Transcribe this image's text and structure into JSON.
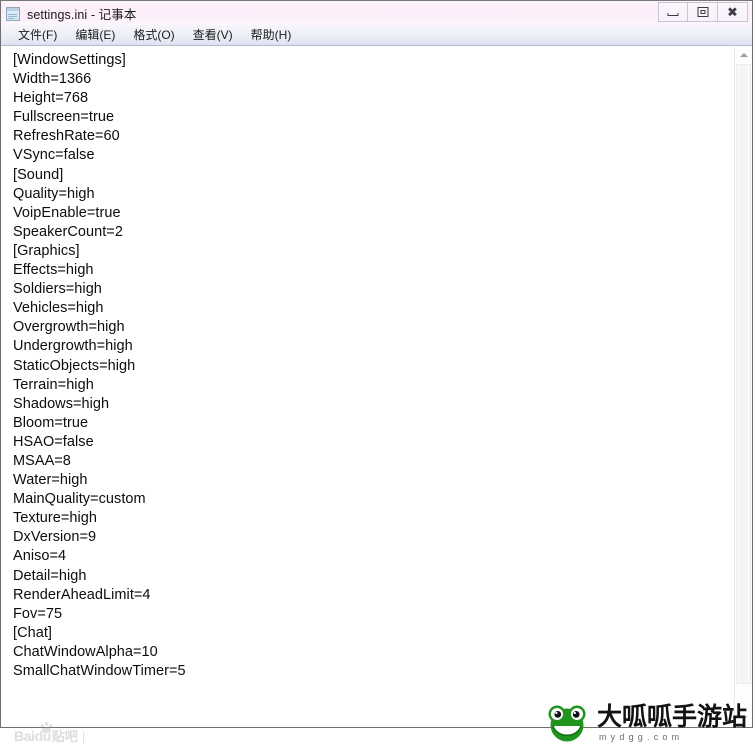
{
  "window": {
    "title": "settings.ini - 记事本",
    "icon": "notepad-icon",
    "controls": {
      "minimize": "最小化",
      "maximize": "最大化",
      "close": "关闭"
    }
  },
  "menu": {
    "items": [
      {
        "label": "文件(F)",
        "name": "menu-file"
      },
      {
        "label": "编辑(E)",
        "name": "menu-edit"
      },
      {
        "label": "格式(O)",
        "name": "menu-format"
      },
      {
        "label": "查看(V)",
        "name": "menu-view"
      },
      {
        "label": "帮助(H)",
        "name": "menu-help"
      }
    ]
  },
  "editor": {
    "filename": "settings.ini",
    "lines": [
      "[WindowSettings]",
      "Width=1366",
      "Height=768",
      "Fullscreen=true",
      "RefreshRate=60",
      "VSync=false",
      "[Sound]",
      "Quality=high",
      "VoipEnable=true",
      "SpeakerCount=2",
      "[Graphics]",
      "Effects=high",
      "Soldiers=high",
      "Vehicles=high",
      "Overgrowth=high",
      "Undergrowth=high",
      "StaticObjects=high",
      "Terrain=high",
      "Shadows=high",
      "Bloom=true",
      "HSAO=false",
      "MSAA=8",
      "Water=high",
      "MainQuality=custom",
      "Texture=high",
      "DxVersion=9",
      "Aniso=4",
      "Detail=high",
      "RenderAheadLimit=4",
      "Fov=75",
      "[Chat]",
      "ChatWindowAlpha=10",
      "SmallChatWindowTimer=5"
    ]
  },
  "scrollbar": {
    "up_arrow": "scroll-up-arrow-icon",
    "down_arrow": "scroll-down-arrow-icon"
  },
  "watermarks": {
    "baidu": {
      "brand": "Baidu",
      "section": "贴吧",
      "separator": "|"
    },
    "site": {
      "title": "大呱呱手游站",
      "domain": "mydgg.com",
      "logo": "frog-icon",
      "colors": {
        "frog_green": "#219421",
        "frog_dark": "#127312",
        "text": "#131313"
      }
    }
  },
  "colors": {
    "title_bar": "#fdeefa",
    "menu_bar": "#e6eaf4",
    "text": "#0d0d0d",
    "window_border": "#6f6f6f"
  }
}
